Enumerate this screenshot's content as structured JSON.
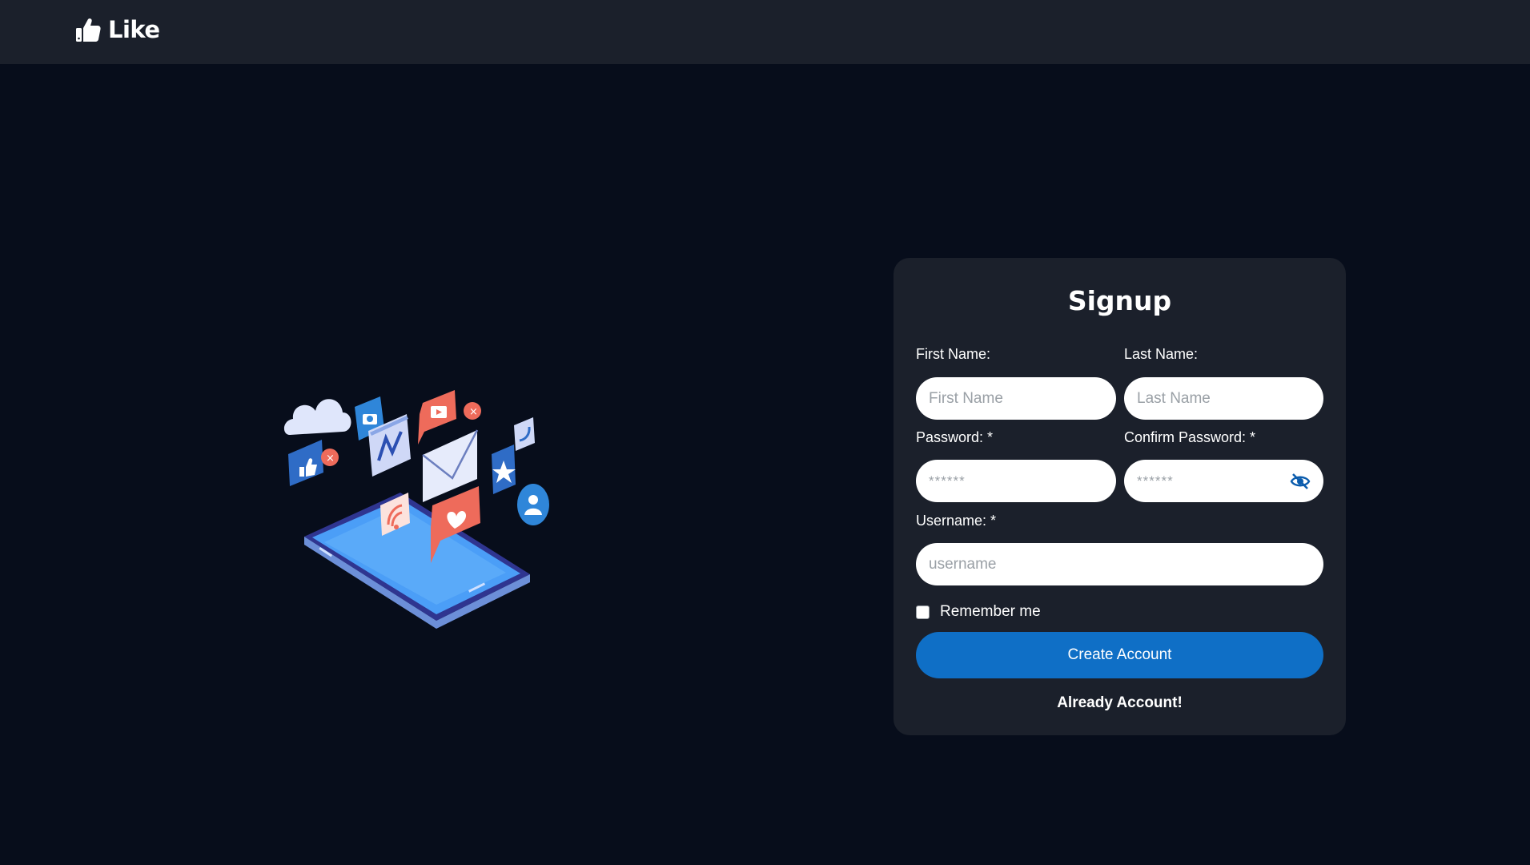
{
  "navbar": {
    "brand_text": "Like",
    "brand_icon": "thumbs-up-icon"
  },
  "illustration": {
    "description_icon": "social-media-phone-illustration"
  },
  "form": {
    "title": "Signup",
    "first_name_label": "First Name:",
    "first_name_placeholder": "First Name",
    "first_name_value": "",
    "last_name_label": "Last Name:",
    "last_name_placeholder": "Last Name",
    "last_name_value": "",
    "password_label": "Password: *",
    "password_placeholder": "******",
    "password_value": "",
    "confirm_password_label": "Confirm Password: *",
    "confirm_password_placeholder": "******",
    "confirm_password_value": "",
    "confirm_password_icon": "eye-slash-icon",
    "username_label": "Username: *",
    "username_placeholder": "username",
    "username_value": "",
    "remember_label": "Remember me",
    "remember_checked": false,
    "submit_label": "Create Account",
    "login_link_label": "Already Account!"
  },
  "colors": {
    "page_background": "#070d1b",
    "surface": "#1b202b",
    "accent": "#0f6fc6",
    "icon_blue": "#0b5cad"
  }
}
